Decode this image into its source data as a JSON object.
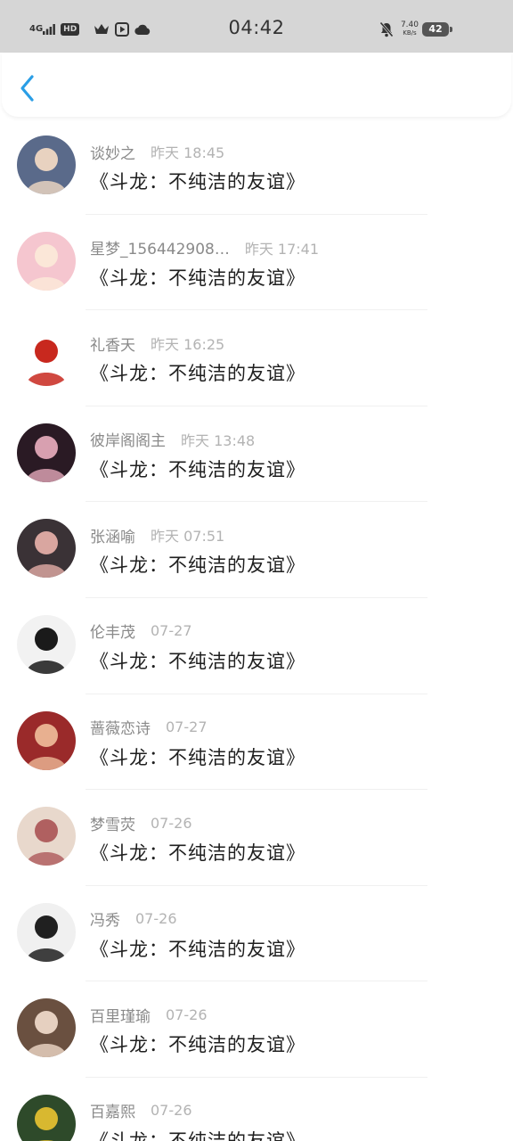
{
  "status_bar": {
    "time": "04:42",
    "network": "4G",
    "hd": "HD",
    "speed_value": "7.40",
    "speed_unit": "KB/s",
    "battery": "42",
    "icons": [
      "signal-icon",
      "crown-icon",
      "play-icon",
      "cloud-icon",
      "mute-bell-icon",
      "wifi-icon",
      "battery-icon"
    ]
  },
  "header": {
    "back_icon": "chevron-left-icon",
    "accent": "#2a9ee6"
  },
  "items": [
    {
      "name": "谈妙之",
      "time": "昨天 18:45",
      "message": "《斗龙：不纯洁的友谊》",
      "avatar_colors": [
        "#5a6a8a",
        "#e8d2c0"
      ]
    },
    {
      "name": "星梦_156442908…",
      "time": "昨天 17:41",
      "message": "《斗龙：不纯洁的友谊》",
      "avatar_colors": [
        "#f5c6cf",
        "#fbe7d8"
      ]
    },
    {
      "name": "礼香天",
      "time": "昨天 16:25",
      "message": "《斗龙：不纯洁的友谊》",
      "avatar_colors": [
        "#ffffff",
        "#c8281e"
      ]
    },
    {
      "name": "彼岸阁阁主",
      "time": "昨天 13:48",
      "message": "《斗龙：不纯洁的友谊》",
      "avatar_colors": [
        "#2a1a24",
        "#d8a0b0"
      ]
    },
    {
      "name": "张涵喻",
      "time": "昨天 07:51",
      "message": "《斗龙：不纯洁的友谊》",
      "avatar_colors": [
        "#3a3236",
        "#d9a6a0"
      ]
    },
    {
      "name": "伦丰茂",
      "time": "07-27",
      "message": "《斗龙：不纯洁的友谊》",
      "avatar_colors": [
        "#f2f2f2",
        "#1a1a1a"
      ]
    },
    {
      "name": "蔷薇恋诗",
      "time": "07-27",
      "message": "《斗龙：不纯洁的友谊》",
      "avatar_colors": [
        "#9a2a2a",
        "#e8b090"
      ]
    },
    {
      "name": "梦雪荧",
      "time": "07-26",
      "message": "《斗龙：不纯洁的友谊》",
      "avatar_colors": [
        "#e8d8cc",
        "#b06060"
      ]
    },
    {
      "name": "冯秀",
      "time": "07-26",
      "message": "《斗龙：不纯洁的友谊》",
      "avatar_colors": [
        "#f0f0f0",
        "#202020"
      ]
    },
    {
      "name": "百里瑾瑜",
      "time": "07-26",
      "message": "《斗龙：不纯洁的友谊》",
      "avatar_colors": [
        "#6a5040",
        "#e6d0c0"
      ]
    },
    {
      "name": "百嘉熙",
      "time": "07-26",
      "message": "《斗龙：不纯洁的友谊》",
      "avatar_colors": [
        "#2e4a2a",
        "#d8b830"
      ]
    }
  ]
}
